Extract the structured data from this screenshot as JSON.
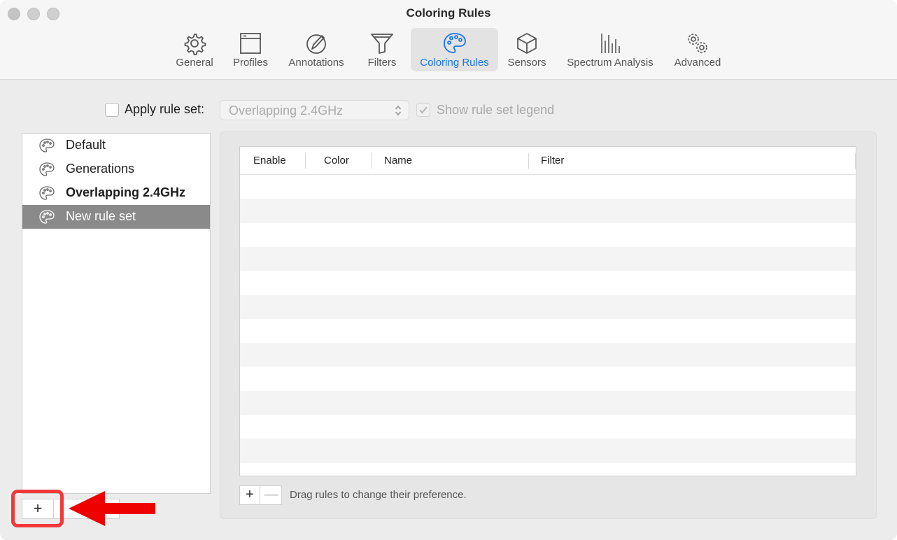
{
  "window": {
    "title": "Coloring Rules"
  },
  "toolbar": {
    "tabs": [
      {
        "label": "General",
        "icon": "gear-icon"
      },
      {
        "label": "Profiles",
        "icon": "window-icon"
      },
      {
        "label": "Annotations",
        "icon": "pen-circle-icon"
      },
      {
        "label": "Filters",
        "icon": "funnel-icon"
      },
      {
        "label": "Coloring Rules",
        "icon": "palette-icon",
        "active": true
      },
      {
        "label": "Sensors",
        "icon": "cube-icon"
      },
      {
        "label": "Spectrum Analysis",
        "icon": "spectrum-bars-icon"
      },
      {
        "label": "Advanced",
        "icon": "gears-icon"
      }
    ],
    "active_color": "#1a73e8"
  },
  "apply_row": {
    "apply_label": "Apply rule set:",
    "apply_checked": false,
    "rule_set_value": "Overlapping 2.4GHz",
    "legend_label": "Show rule set legend",
    "legend_checked": true
  },
  "rule_sets": [
    {
      "label": "Default",
      "bold": false,
      "selected": false
    },
    {
      "label": "Generations",
      "bold": false,
      "selected": false
    },
    {
      "label": "Overlapping 2.4GHz",
      "bold": true,
      "selected": false
    },
    {
      "label": "New rule set",
      "bold": false,
      "selected": true
    }
  ],
  "sidebar_buttons": {
    "add": "+"
  },
  "rules_table": {
    "columns": [
      "Enable",
      "Color",
      "Name",
      "Filter"
    ],
    "rows": []
  },
  "rules_buttons": {
    "add": "+",
    "remove": "—"
  },
  "hint": "Drag rules to change their preference.",
  "annotation": {
    "highlight_color": "#f03a3a"
  }
}
